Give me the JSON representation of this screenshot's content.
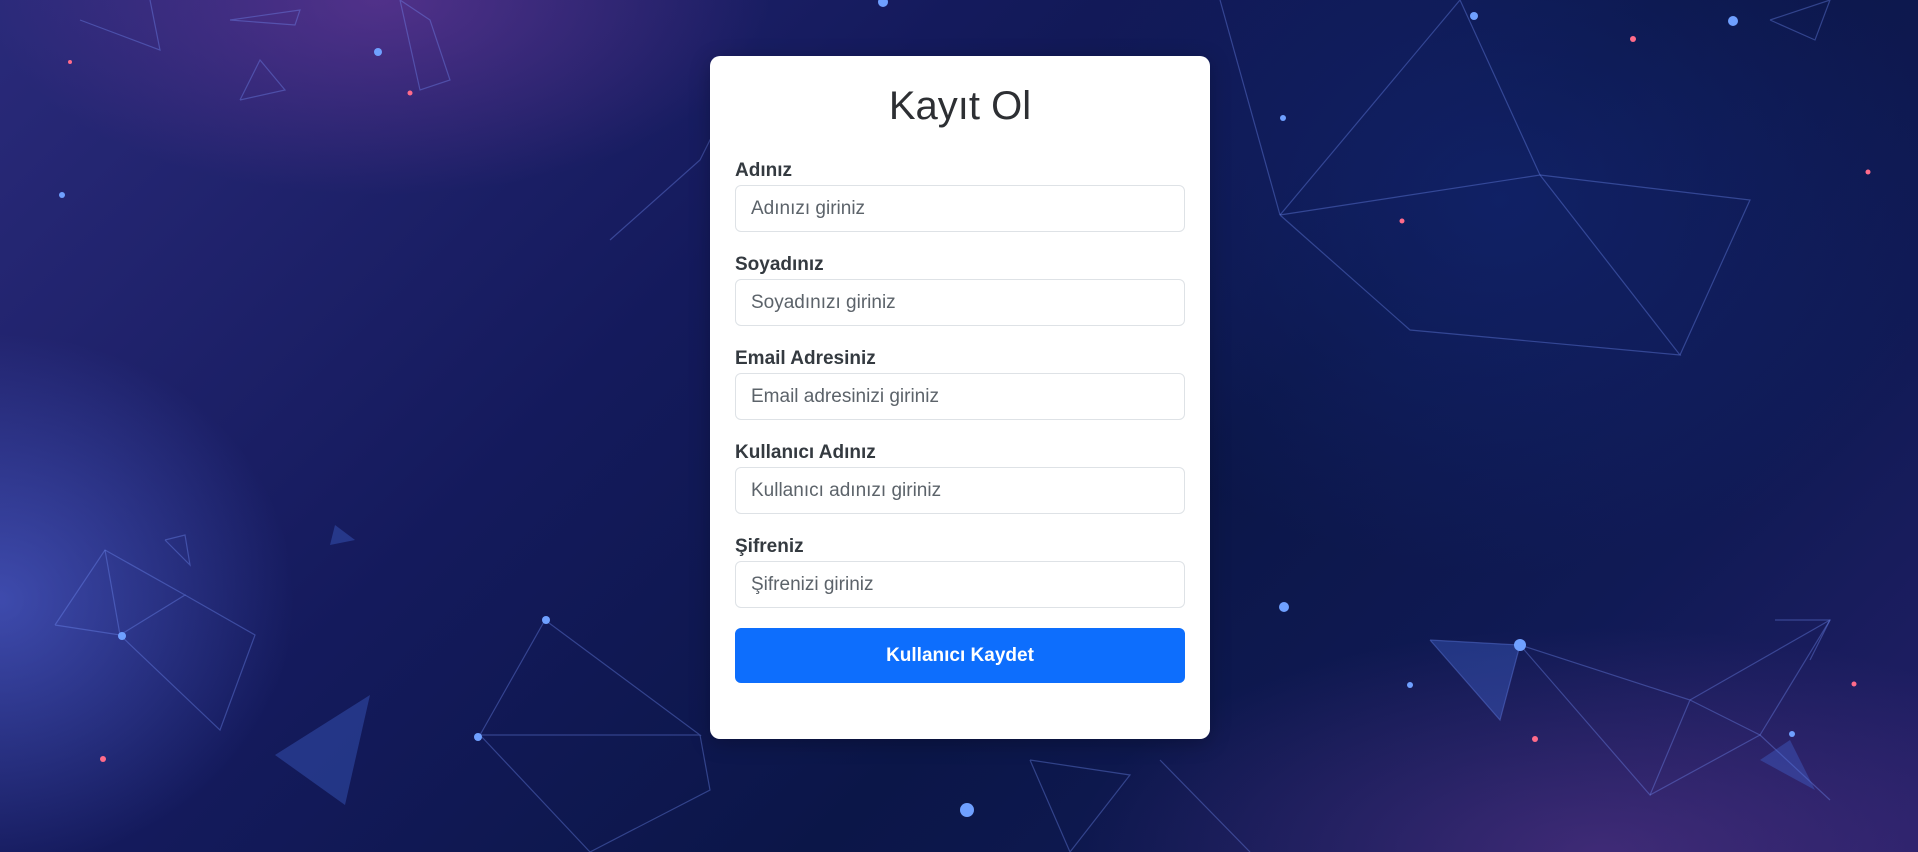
{
  "form": {
    "title": "Kayıt Ol",
    "fields": [
      {
        "label": "Adınız",
        "placeholder": "Adınızı giriniz",
        "value": ""
      },
      {
        "label": "Soyadınız",
        "placeholder": "Soyadınızı giriniz",
        "value": ""
      },
      {
        "label": "Email Adresiniz",
        "placeholder": "Email adresinizi giriniz",
        "value": ""
      },
      {
        "label": "Kullanıcı Adınız",
        "placeholder": "Kullanıcı adınızı giriniz",
        "value": ""
      },
      {
        "label": "Şifreniz",
        "placeholder": "Şifrenizi giriniz",
        "value": ""
      }
    ],
    "submit_label": "Kullanıcı Kaydet"
  },
  "colors": {
    "accent": "#0d6efd",
    "card": "#ffffff",
    "background": "#0b1648"
  }
}
